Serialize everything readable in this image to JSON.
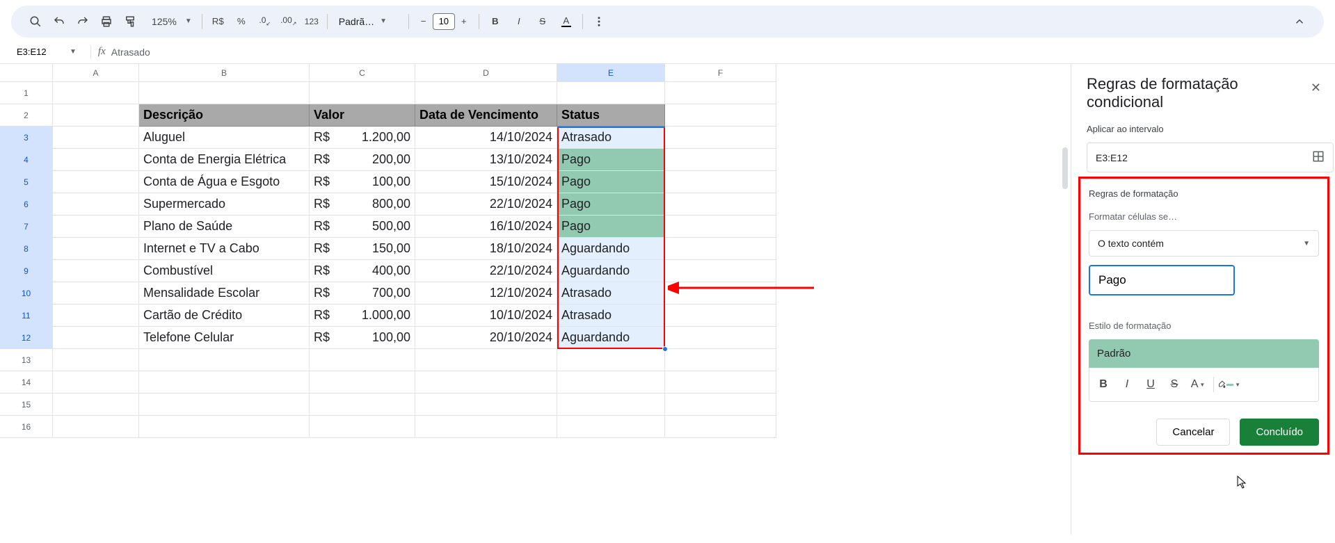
{
  "toolbar": {
    "zoom": "125%",
    "currency_symbol": "R$",
    "percent": "%",
    "dec_decrease": ".0",
    "dec_increase": ".00",
    "num_123": "123",
    "font_name": "Padrã…",
    "font_size": "10"
  },
  "formula_bar": {
    "cell_ref": "E3:E12",
    "fx_label": "fx",
    "content": "Atrasado"
  },
  "columns": [
    "A",
    "B",
    "C",
    "D",
    "E",
    "F"
  ],
  "rows_visible": 16,
  "headers": {
    "descricao": "Descrição",
    "valor": "Valor",
    "data": "Data de Vencimento",
    "status": "Status"
  },
  "data_rows": [
    {
      "desc": "Aluguel",
      "cur": "R$",
      "val": "1.200,00",
      "date": "14/10/2024",
      "status": "Atrasado",
      "pago": false
    },
    {
      "desc": "Conta de Energia Elétrica",
      "cur": "R$",
      "val": "200,00",
      "date": "13/10/2024",
      "status": "Pago",
      "pago": true
    },
    {
      "desc": "Conta de Água e Esgoto",
      "cur": "R$",
      "val": "100,00",
      "date": "15/10/2024",
      "status": "Pago",
      "pago": true
    },
    {
      "desc": "Supermercado",
      "cur": "R$",
      "val": "800,00",
      "date": "22/10/2024",
      "status": "Pago",
      "pago": true
    },
    {
      "desc": "Plano de Saúde",
      "cur": "R$",
      "val": "500,00",
      "date": "16/10/2024",
      "status": "Pago",
      "pago": true
    },
    {
      "desc": "Internet e TV a Cabo",
      "cur": "R$",
      "val": "150,00",
      "date": "18/10/2024",
      "status": "Aguardando",
      "pago": false
    },
    {
      "desc": "Combustível",
      "cur": "R$",
      "val": "400,00",
      "date": "22/10/2024",
      "status": "Aguardando",
      "pago": false
    },
    {
      "desc": "Mensalidade Escolar",
      "cur": "R$",
      "val": "700,00",
      "date": "12/10/2024",
      "status": "Atrasado",
      "pago": false
    },
    {
      "desc": "Cartão de Crédito",
      "cur": "R$",
      "val": "1.000,00",
      "date": "10/10/2024",
      "status": "Atrasado",
      "pago": false
    },
    {
      "desc": "Telefone Celular",
      "cur": "R$",
      "val": "100,00",
      "date": "20/10/2024",
      "status": "Aguardando",
      "pago": false
    }
  ],
  "sidebar": {
    "title": "Regras de formatação condicional",
    "apply_label": "Aplicar ao intervalo",
    "range": "E3:E12",
    "rules_label": "Regras de formatação",
    "format_if_label": "Formatar células se…",
    "condition": "O texto contém",
    "condition_value": "Pago",
    "style_label": "Estilo de formatação",
    "style_preview": "Padrão",
    "cancel": "Cancelar",
    "done": "Concluído"
  }
}
